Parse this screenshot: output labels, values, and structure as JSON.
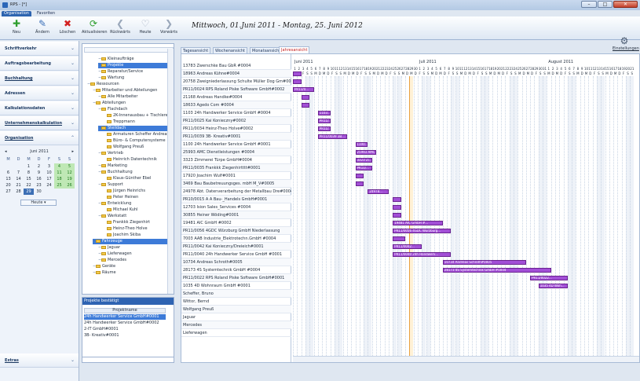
{
  "window": {
    "title": "RPS - [*]"
  },
  "ribbon_tabs": [
    "Organisation",
    "Favoriten"
  ],
  "toolbar": [
    {
      "label": "Neu",
      "icon": "plus-icon",
      "color": "#2e9e2e"
    },
    {
      "label": "Ändern",
      "icon": "edit-icon",
      "color": "#3a6fb8"
    },
    {
      "label": "Löschen",
      "icon": "delete-icon",
      "color": "#d22020"
    },
    {
      "label": "Aktualisieren",
      "icon": "refresh-icon",
      "color": "#2e9e2e"
    },
    {
      "label": "Rückwärts",
      "icon": "back-icon",
      "color": "#9aa8bb"
    },
    {
      "label": "Heute",
      "icon": "heart-icon",
      "color": "#9aa8bb"
    },
    {
      "label": "Vorwärts",
      "icon": "forward-icon",
      "color": "#9aa8bb"
    }
  ],
  "date_range": "Mittwoch, 01.Juni 2011  -  Montag, 25. Juni 2012",
  "settings_label": "Einstellungen",
  "nav": [
    "Schriftverkehr",
    "Auftragsbearbeitung",
    "Buchhaltung",
    "Adressen",
    "Kalkulationsdaten",
    "Unternehmenskalkulation",
    "Organisation",
    "Extras"
  ],
  "calendar": {
    "month": "Juni 2011",
    "headers": [
      "M",
      "D",
      "M",
      "D",
      "F",
      "S",
      "S"
    ],
    "weeks": [
      [
        "",
        "",
        "1",
        "2",
        "3",
        "4",
        "5"
      ],
      [
        "6",
        "7",
        "8",
        "9",
        "10",
        "11",
        "12"
      ],
      [
        "13",
        "14",
        "15",
        "16",
        "17",
        "18",
        "19"
      ],
      [
        "20",
        "21",
        "22",
        "23",
        "24",
        "25",
        "26"
      ],
      [
        "27",
        "28",
        "29",
        "30",
        "",
        "",
        ""
      ]
    ],
    "selected": "29",
    "today_label": "Heute"
  },
  "tree": [
    {
      "label": "Kleinaufträge",
      "level": 2
    },
    {
      "label": "Projekte",
      "level": 2,
      "selected": true
    },
    {
      "label": "Reparatur/Service",
      "level": 2
    },
    {
      "label": "Wartung",
      "level": 2
    },
    {
      "label": "Ressourcen",
      "level": 0
    },
    {
      "label": "Mitarbeiter und Abteilungen",
      "level": 1
    },
    {
      "label": "Alle Mitarbeiter",
      "level": 2
    },
    {
      "label": "Abteilungen",
      "level": 1
    },
    {
      "label": "Flachdach",
      "level": 2
    },
    {
      "label": "2K-Innenausbau + Tischlerei",
      "level": 3
    },
    {
      "label": "Treppmann",
      "level": 3
    },
    {
      "label": "Steildach",
      "level": 2,
      "selected": true
    },
    {
      "label": "Armaturen Scheffer Andreas",
      "level": 3
    },
    {
      "label": "Büro- & Computersysteme",
      "level": 3
    },
    {
      "label": "Wolfgang Preuß",
      "level": 3
    },
    {
      "label": "Vertrieb",
      "level": 2
    },
    {
      "label": "Heinrich Datentechnik",
      "level": 3
    },
    {
      "label": "Marketing",
      "level": 2
    },
    {
      "label": "Buchhaltung",
      "level": 2
    },
    {
      "label": "Klaus-Günther Ebel",
      "level": 3
    },
    {
      "label": "Support",
      "level": 2
    },
    {
      "label": "Jürgen Heinrichs",
      "level": 3
    },
    {
      "label": "Peter Heinen",
      "level": 3
    },
    {
      "label": "Entwicklung",
      "level": 2
    },
    {
      "label": "Michael Kuhl",
      "level": 3
    },
    {
      "label": "Werkstatt",
      "level": 2
    },
    {
      "label": "Frankkk Ziegenhirt",
      "level": 3
    },
    {
      "label": "Heinz-Theo Holve",
      "level": 3
    },
    {
      "label": "Joachim Skiba",
      "level": 3
    },
    {
      "label": "Fahrzeuge",
      "level": 1,
      "selected": true
    },
    {
      "label": "Jaguar",
      "level": 2
    },
    {
      "label": "Lieferwagen",
      "level": 2
    },
    {
      "label": "Mercedes",
      "level": 2
    },
    {
      "label": "Geräte",
      "level": 1
    },
    {
      "label": "Räume",
      "level": 1
    }
  ],
  "projects": {
    "dropdown": "Projekte bestätigt",
    "column": "Projektname",
    "rows": [
      "24h Handwerker Service GmbH#0001",
      "24h Handwerker Service GmbH#0002",
      "2-IT GmbH#0001",
      "3B- Kreativ#0001"
    ],
    "selected_index": 0
  },
  "view_tabs": [
    "Tagesansicht",
    "Wochenansicht",
    "Monatsansicht",
    "Jahresansicht"
  ],
  "active_view": 3,
  "gantt": {
    "months": [
      "Juni 2011",
      "Juli 2011",
      "August 2011"
    ],
    "rows": [
      "13783  Zwerschke Bau GbR #0004",
      "18963  Andreas Kühne#0004",
      "20758  Zweigniederlassung Schulte Müller Dog Gm#0004",
      "PR11/0024  RPS  Roland Piske Software GmbH#0002",
      "21168  Andreas Handke#0004",
      "18633  Agedo Com #0004",
      "1103  24h Handwerker Service GmbH #0004",
      "PR11/0025  Kai Konieczny#0002",
      "PR11/0034  Heinz-Theo Holve#0002",
      "PR11/0039  3B- Kreativ#0001",
      "1100  24h Handwerker Service GmbH #0001",
      "25993  AMC Dienstleistungen #0004",
      "3323  Zimmerei Türpe GmbH#0004",
      "PR11/0035  Frankkk Ziegenhirtttt#0001",
      "17920  Joachim Wulf#0001",
      "3469  Bau  Baubetreuungsges. mbH M_V#0005",
      "24978  Abt. Datenverarbeitung der Metallbau Dre#0004",
      "PR10/0015  A  A Bau-_Handels GmbH#0001",
      "12703  Ision Sales_Services #0004",
      "30855  Heiner Wöding#0001",
      "19481  AIC GmbH #0002",
      "PR11/0056  4GDC Würzburg GmbH Niederlassung",
      "7003  AAB Industrie_Elektrotechn.GmbH #0004",
      "PR11/0042  Kai Konieczny/Dreieich#0001",
      "PR11/0040  24h Handwerker Service GmbH #0001",
      "10734  Andreas Schroth#0005",
      "28173  4S Systemtechnik GmbH #0004",
      "PR11/0022  RPS  Roland Piske Software GmbH#0001",
      "1035  4D Wohnraum GmbH #0001",
      "Scheffer, Bruno",
      "Wittor, Bernd",
      "Wolfgang Preuß",
      "Jaguar",
      "Mercedes",
      "Lieferwagen"
    ],
    "bars": [
      {
        "row": 1,
        "start": 1,
        "end": 2,
        "label": ""
      },
      {
        "row": 2,
        "start": 1,
        "end": 2,
        "label": ""
      },
      {
        "row": 3,
        "start": 1,
        "end": 5,
        "label": "PR11/0..."
      },
      {
        "row": 4,
        "start": 3,
        "end": 4,
        "label": ""
      },
      {
        "row": 5,
        "start": 3,
        "end": 4,
        "label": ""
      },
      {
        "row": 6,
        "start": 7,
        "end": 9,
        "label": "1103..."
      },
      {
        "row": 7,
        "start": 7,
        "end": 9,
        "label": "PR11/..."
      },
      {
        "row": 8,
        "start": 7,
        "end": 9,
        "label": "PR11/..."
      },
      {
        "row": 9,
        "start": 7,
        "end": 13,
        "label": "PR11/0039 3B..."
      },
      {
        "row": 10,
        "start": 16,
        "end": 18,
        "label": "1100..."
      },
      {
        "row": 11,
        "start": 16,
        "end": 20,
        "label": "25993 AMC..."
      },
      {
        "row": 12,
        "start": 16,
        "end": 19,
        "label": "3323 Zi..."
      },
      {
        "row": 13,
        "start": 16,
        "end": 19,
        "label": "PR11/..."
      },
      {
        "row": 14,
        "start": 16,
        "end": 17,
        "label": ""
      },
      {
        "row": 15,
        "start": 16,
        "end": 17,
        "label": ""
      },
      {
        "row": 16,
        "start": 19,
        "end": 23,
        "label": "24978..."
      },
      {
        "row": 17,
        "start": 25,
        "end": 26,
        "label": ""
      },
      {
        "row": 18,
        "start": 25,
        "end": 26,
        "label": ""
      },
      {
        "row": 19,
        "start": 25,
        "end": 26,
        "label": ""
      },
      {
        "row": 20,
        "start": 25,
        "end": 36,
        "label": "19481 AIC GmbH #..."
      },
      {
        "row": 21,
        "start": 25,
        "end": 38,
        "label": "PR11/0056 4GDC Würzburg..."
      },
      {
        "row": 22,
        "start": 25,
        "end": 27,
        "label": ""
      },
      {
        "row": 23,
        "start": 25,
        "end": 31,
        "label": "PR11/0042..."
      },
      {
        "row": 24,
        "start": 25,
        "end": 38,
        "label": "PR11/0040 24h Handwerk..."
      },
      {
        "row": 25,
        "start": 37,
        "end": 56,
        "label": "10734 Andreas Schroth#0005"
      },
      {
        "row": 26,
        "start": 37,
        "end": 62,
        "label": "28173 4S Systemtechnik GmbH #0004"
      },
      {
        "row": 27,
        "start": 58,
        "end": 66,
        "label": "PR11/0022..."
      },
      {
        "row": 28,
        "start": 60,
        "end": 66,
        "label": "1035 4D Woh..."
      }
    ]
  }
}
